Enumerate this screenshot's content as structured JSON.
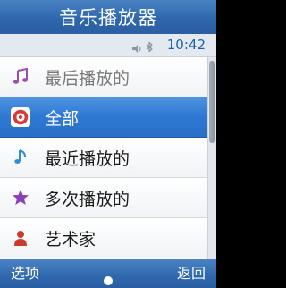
{
  "title": "音乐播放器",
  "status": {
    "time": "10:42",
    "icons": [
      "speaker-icon",
      "bluetooth-icon"
    ]
  },
  "menu": {
    "items": [
      {
        "label": "最后播放的",
        "icon": "music-note-icon"
      },
      {
        "label": "全部",
        "icon": "disc-icon"
      },
      {
        "label": "最近播放的",
        "icon": "music-note-blue-icon"
      },
      {
        "label": "多次播放的",
        "icon": "star-icon"
      },
      {
        "label": "艺术家",
        "icon": "person-icon"
      }
    ],
    "selected": "全部"
  },
  "softkeys": {
    "left": "选项",
    "right": "返回"
  },
  "colors": {
    "bar": "#2f67ad",
    "selected": "#2e78d4",
    "time": "#1f5fb0"
  }
}
